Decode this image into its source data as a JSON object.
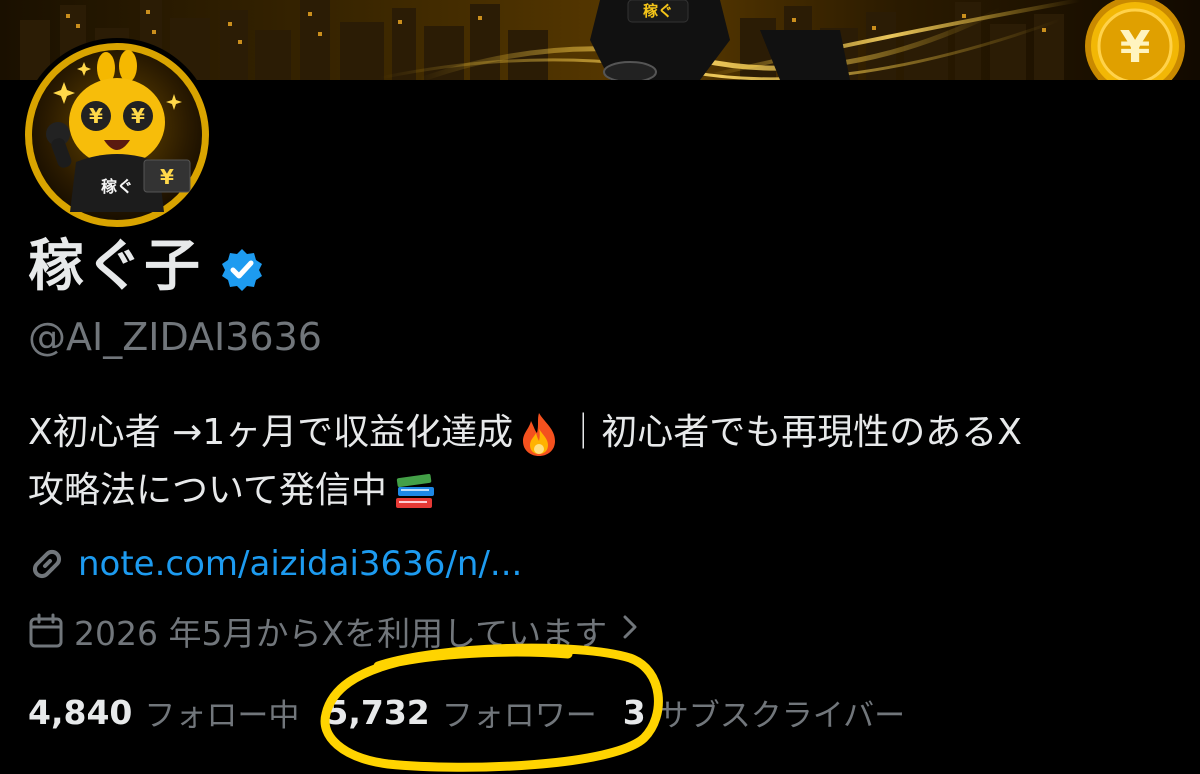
{
  "profile": {
    "display_name": "稼ぐ子",
    "handle": "@AI_ZIDAI3636",
    "verified": true,
    "bio_line1_a": "X初心者 →1ヶ月で収益化達成",
    "bio_line1_emoji": "fire-emoji",
    "bio_line1_b": "｜初心者でも再現性のあるX",
    "bio_line2": "攻略法について発信中",
    "bio_line2_emoji": "books-emoji",
    "link_text": "note.com/aizidai3636/n/...",
    "joined_text": "2026 年5月からXを利用しています",
    "avatar_badge_text": "稼ぐ",
    "banner_badge_text": "稼ぐ"
  },
  "stats": {
    "following_count": "4,840",
    "following_label": "フォロー中",
    "followers_count": "5,732",
    "followers_label": "フォロワー",
    "subscribers_count": "3",
    "subscribers_label": "サブスクライバー"
  },
  "colors": {
    "background": "#000000",
    "text_primary": "#e7e9ea",
    "text_secondary": "#71767b",
    "link": "#1d9bf0",
    "verified": "#1d9bf0",
    "highlight_annotation": "#ffd400",
    "gold": "#f5b800"
  },
  "icons": {
    "link": "link-icon",
    "calendar": "calendar-icon",
    "chevron": "chevron-right-icon",
    "verified": "verified-badge-icon",
    "yen_coin": "yen-coin-icon"
  }
}
